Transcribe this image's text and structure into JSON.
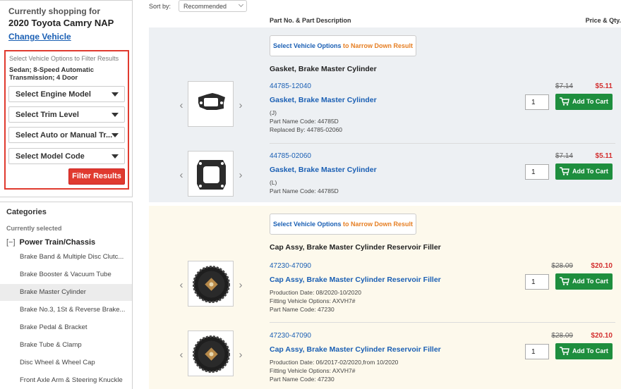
{
  "sidebar": {
    "shopping_label": "Currently shopping for",
    "vehicle": "2020 Toyota Camry NAP",
    "change_vehicle": "Change Vehicle",
    "filter": {
      "title": "Select Vehicle Options to Filter Results",
      "description": "Sedan; 8-Speed Automatic Transmission; 4 Door",
      "selects": [
        "Select Engine Model",
        "Select Trim Level",
        "Select Auto or Manual Tr...",
        "Select Model Code"
      ],
      "button": "Filter Results"
    },
    "categories": {
      "title": "Categories",
      "currently_selected_label": "Currently selected",
      "toggle": "[−]",
      "current": "Power Train/Chassis",
      "items": [
        "Brake Band & Multiple Disc Clutc...",
        "Brake Booster & Vacuum Tube",
        "Brake Master Cylinder",
        "Brake No.3, 1St & Reverse Brake...",
        "Brake Pedal & Bracket",
        "Brake Tube & Clamp",
        "Disc Wheel & Wheel Cap",
        "Front Axle Arm & Steering Knuckle"
      ],
      "active_index": 2
    }
  },
  "main": {
    "sort_label": "Sort by:",
    "sort_value": "Recommended",
    "col_part": "Part No. & Part Description",
    "col_price": "Price & Qty.",
    "narrow_link": "Select Vehicle Options",
    "narrow_rest": " to Narrow Down Result",
    "add_to_cart": "Add To Cart",
    "groups": [
      {
        "title": "Gasket, Brake Master Cylinder",
        "items": [
          {
            "part_no": "44785-12040",
            "desc": "Gasket, Brake Master Cylinder",
            "notes": [
              "(J)",
              "Part Name Code: 44785D",
              "Replaced By: 44785-02060"
            ],
            "old_price": "$7.14",
            "price": "$5.11",
            "qty": "1",
            "image": "gasket-1"
          },
          {
            "part_no": "44785-02060",
            "desc": "Gasket, Brake Master Cylinder",
            "notes": [
              "(L)",
              "Part Name Code: 44785D"
            ],
            "old_price": "$7.14",
            "price": "$5.11",
            "qty": "1",
            "image": "gasket-2"
          }
        ]
      },
      {
        "title": "Cap Assy, Brake Master Cylinder Reservoir Filler",
        "items": [
          {
            "part_no": "47230-47090",
            "desc": "Cap Assy, Brake Master Cylinder Reservoir Filler",
            "notes": [
              "Production Date: 08/2020-10/2020",
              "Fitting Vehicle Options: AXVH7#",
              "Part Name Code: 47230"
            ],
            "old_price": "$28.09",
            "price": "$20.10",
            "qty": "1",
            "image": "cap"
          },
          {
            "part_no": "47230-47090",
            "desc": "Cap Assy, Brake Master Cylinder Reservoir Filler",
            "notes": [
              "Production Date: 06/2017-02/2020,from 10/2020",
              "Fitting Vehicle Options: AXVH7#",
              "Part Name Code: 47230"
            ],
            "old_price": "$28.09",
            "price": "$20.10",
            "qty": "1",
            "image": "cap"
          }
        ]
      }
    ]
  },
  "colors": {
    "accent": "#1a5fb4",
    "alert": "#e03a2f",
    "cart": "#1e8e3e",
    "price": "#d32f2f"
  }
}
